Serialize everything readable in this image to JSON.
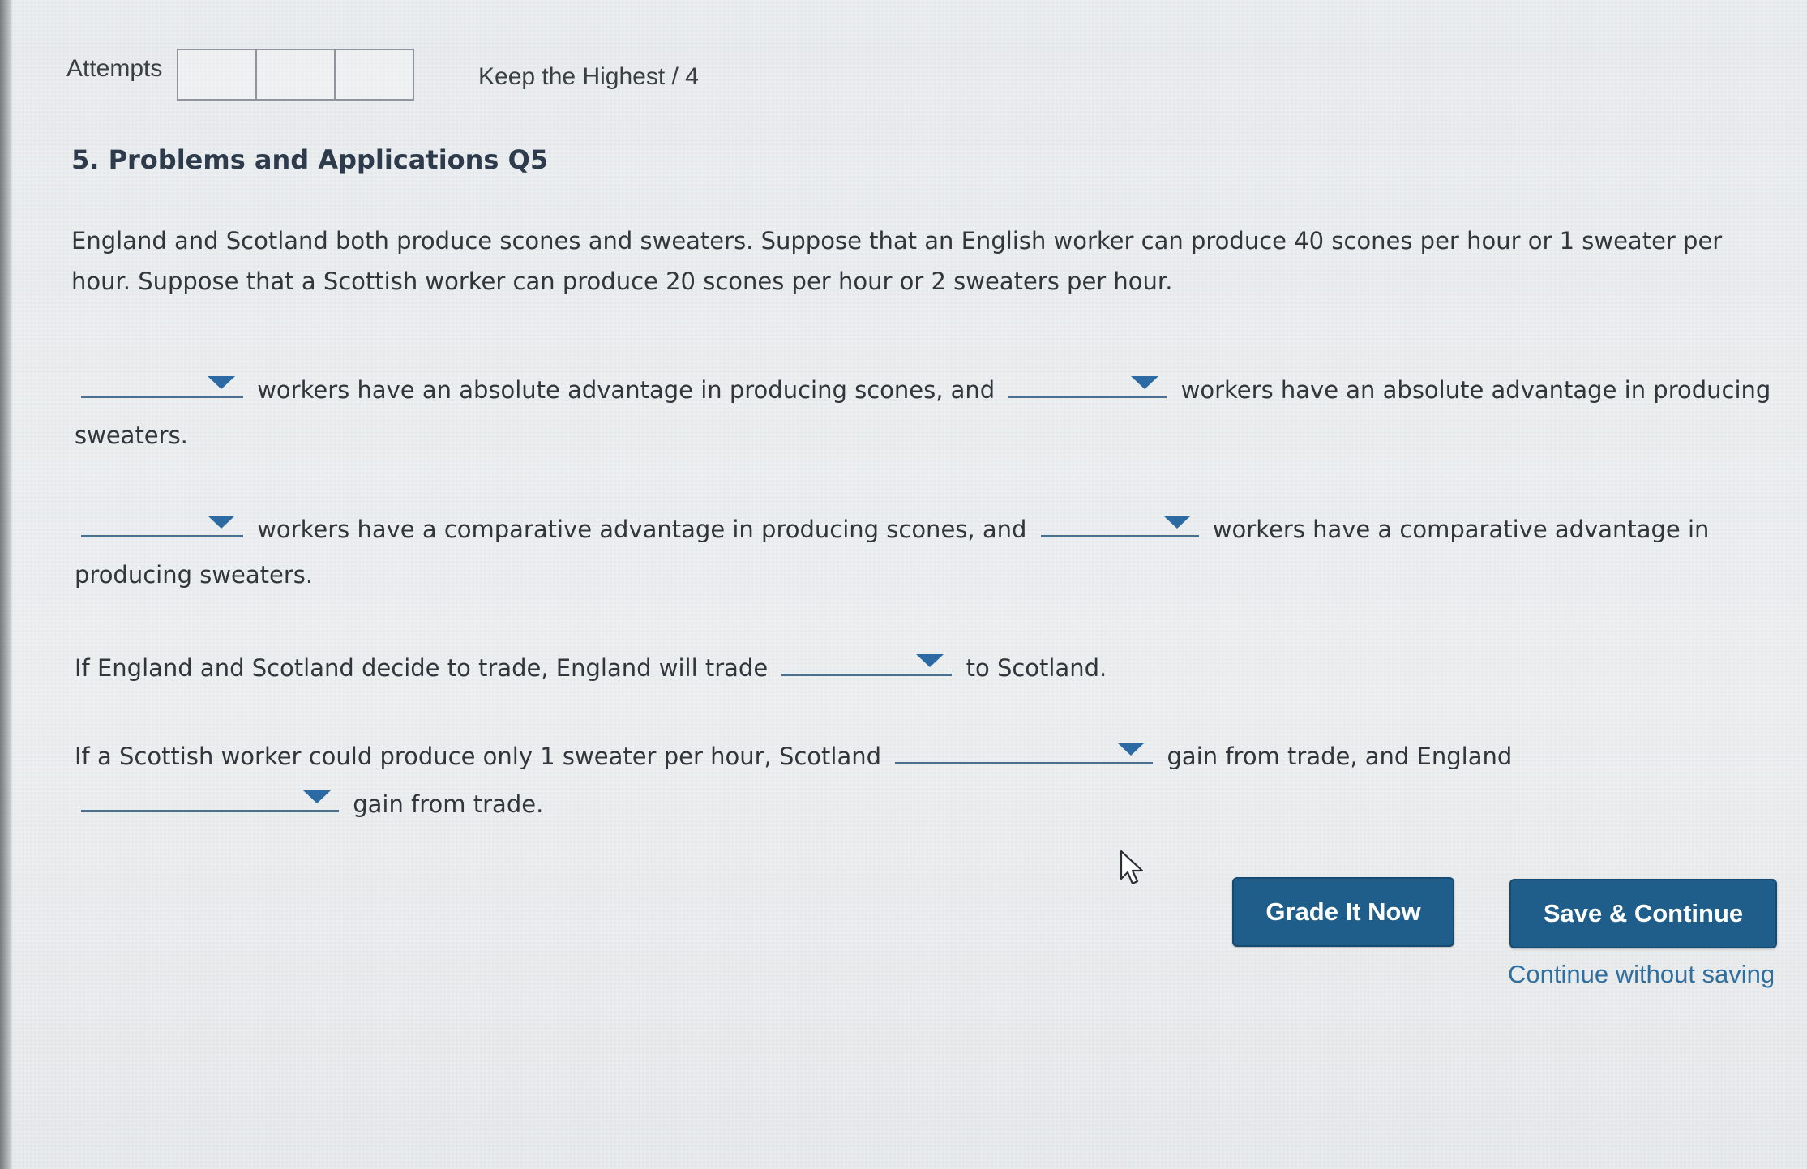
{
  "header": {
    "attempts_label": "Attempts",
    "grading_note": "Keep the Highest / 4"
  },
  "question": {
    "title": "5. Problems and Applications Q5",
    "intro": "England and Scotland both produce scones and sweaters. Suppose that an English worker can produce 40 scones per hour or 1 sweater per hour. Suppose that a Scottish worker can produce 20 scones per hour or 2 sweaters per hour.",
    "items": [
      {
        "part_a": "workers have an absolute advantage in producing scones, and",
        "part_b": "workers have an absolute advantage in producing sweaters."
      },
      {
        "part_a": "workers have a comparative advantage in producing scones, and",
        "part_b": "workers have a comparative advantage in producing sweaters."
      },
      {
        "part_a": "If England and Scotland decide to trade, England will trade",
        "part_b": "to Scotland."
      },
      {
        "part_a": "If a Scottish worker could produce only 1 sweater per hour, Scotland",
        "part_b": "gain from trade, and England",
        "part_c": "gain from trade."
      }
    ]
  },
  "buttons": {
    "grade": "Grade It Now",
    "save": "Save & Continue",
    "continue_link": "Continue without saving"
  },
  "icons": {
    "dropdown": "chevron-down-icon",
    "cursor": "mouse-pointer-icon"
  },
  "colors": {
    "button_bg": "#1f5d8b",
    "dropdown_arrow": "#2b6aa3",
    "link": "#2f6f9f"
  }
}
